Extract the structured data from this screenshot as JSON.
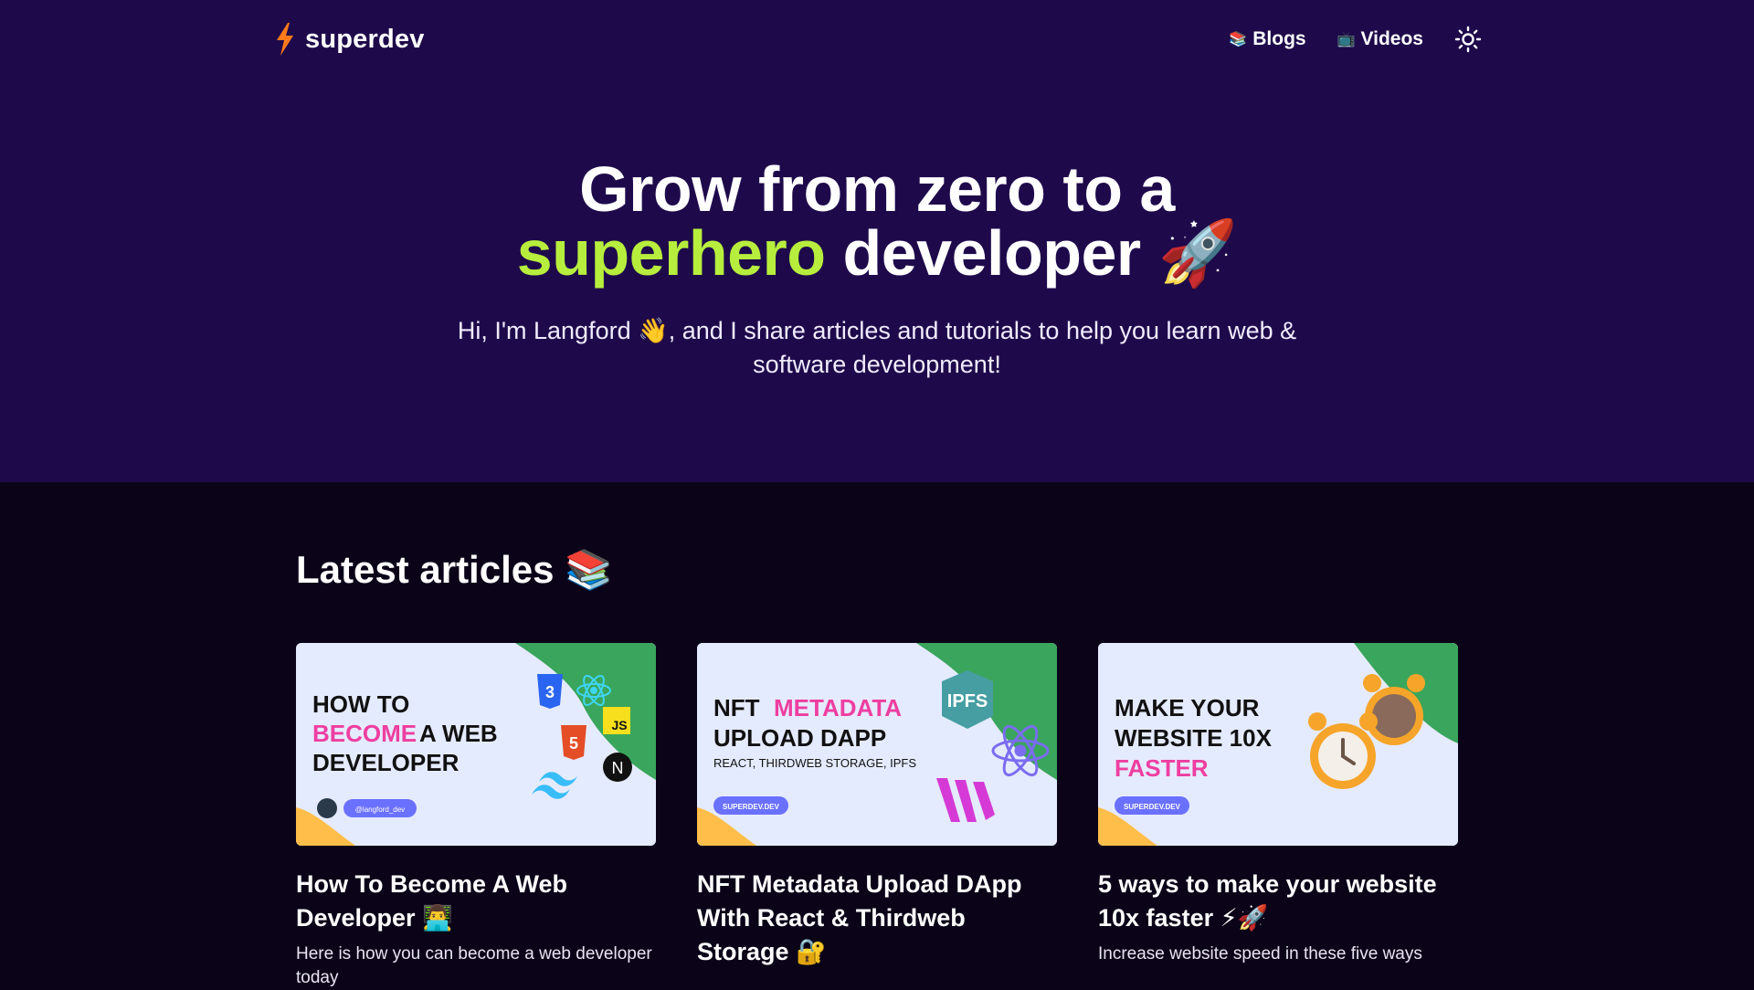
{
  "nav": {
    "logo_text": "superdev",
    "blogs_emoji": "📚",
    "blogs_label": "Blogs",
    "videos_emoji": "📺",
    "videos_label": "Videos"
  },
  "hero": {
    "title_line1": "Grow from zero to a",
    "title_accent": "superhero",
    "title_rest": " developer 🚀",
    "subtitle": "Hi, I'm Langford 👋, and I share articles and tutorials to help you learn web & software development!"
  },
  "articles": {
    "section_title": "Latest articles 📚",
    "items": [
      {
        "thumb_lines": [
          "HOW TO",
          "BECOME",
          "A WEB",
          "DEVELOPER"
        ],
        "thumb_handle": "@langford_dev",
        "title": "How To Become A Web Developer 👨‍💻",
        "desc": "Here is how you can become a web developer today"
      },
      {
        "thumb_lines": [
          "NFT",
          "METADATA",
          "UPLOAD DAPP"
        ],
        "thumb_sub": "REACT, THIRDWEB STORAGE, IPFS",
        "thumb_badge": "SUPERDEV.DEV",
        "thumb_ipfs": "IPFS",
        "title": "NFT Metadata Upload DApp With React & Thirdweb Storage 🔐",
        "desc": ""
      },
      {
        "thumb_lines": [
          "MAKE YOUR",
          "WEBSITE 10X",
          "FASTER"
        ],
        "thumb_badge": "SUPERDEV.DEV",
        "title": "5 ways to make your website 10x faster ⚡🚀",
        "desc": "Increase website speed in these five ways"
      }
    ]
  },
  "colors": {
    "hero_bg": "#1e0a4b",
    "page_bg": "#0b0418",
    "accent_green": "#b7ee3d",
    "logo_orange": "#ff7a1a",
    "thumb_pink": "#ee3ea0",
    "thumb_green": "#3aa55c"
  },
  "icons": [
    "bolt-logo-icon",
    "sun-icon",
    "css3-icon",
    "react-icon",
    "js-icon",
    "html5-icon",
    "tailwind-icon",
    "nextjs-icon",
    "ipfs-icon",
    "thirdweb-icon",
    "alarm-clock-icon"
  ]
}
